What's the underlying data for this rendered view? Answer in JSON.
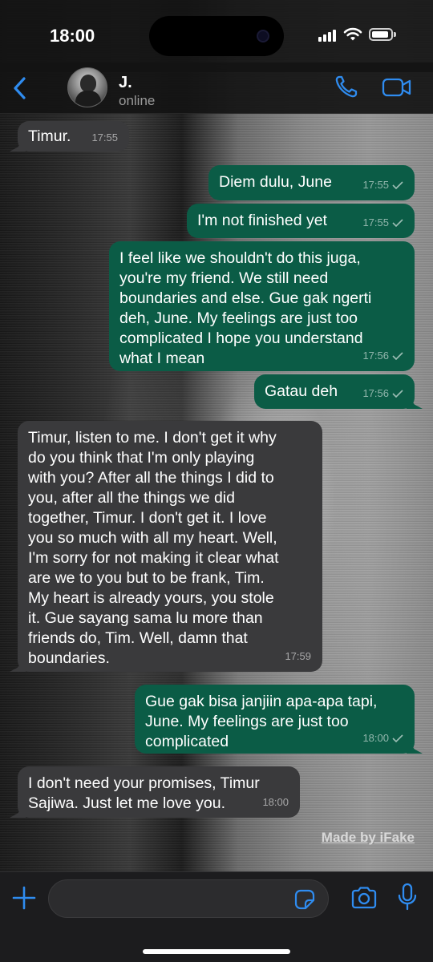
{
  "status_bar": {
    "time": "18:00"
  },
  "header": {
    "contact_name": "J.",
    "contact_status": "online"
  },
  "messages": [
    {
      "direction": "in",
      "text": "Timur.",
      "time": "17:55"
    },
    {
      "direction": "out",
      "text": "Diem dulu, June",
      "time": "17:55",
      "read": true
    },
    {
      "direction": "out",
      "text": "I'm not finished yet",
      "time": "17:55",
      "read": true
    },
    {
      "direction": "out",
      "text": "I feel like we shouldn't do this juga,\nyou're my friend. We still need\nboundaries and else. Gue gak ngerti\ndeh, June. My feelings are just too\ncomplicated I hope you understand\nwhat I mean",
      "time": "17:56",
      "read": true
    },
    {
      "direction": "out",
      "text": "Gatau deh",
      "time": "17:56",
      "read": true
    },
    {
      "direction": "in",
      "text": "Timur, listen to me. I don't get it why\ndo you think that I'm only playing\nwith you? After all the things I did to\nyou, after all the things we did\ntogether, Timur. I don't get it. I love\nyou so much with all my heart. Well,\nI'm sorry for not making it clear what\nare we to you but to be frank, Tim.\nMy heart is already yours, you stole\nit. Gue sayang sama lu more than\nfriends do, Tim. Well, damn that\nboundaries.",
      "time": "17:59"
    },
    {
      "direction": "out",
      "text": "Gue gak bisa janjiin apa-apa tapi,\nJune. My feelings are just too\ncomplicated",
      "time": "18:00",
      "read": true
    },
    {
      "direction": "in",
      "text": "I don't need your promises, Timur\nSajiwa. Just let me love you.",
      "time": "18:00"
    }
  ],
  "watermark": "Made by iFake",
  "input": {
    "value": "",
    "placeholder": ""
  },
  "colors": {
    "accent": "#2f8cf0",
    "outgoing_bubble": "#0b5c46",
    "incoming_bubble": "#3a3a3c",
    "bar_background": "#1c1c1e"
  }
}
